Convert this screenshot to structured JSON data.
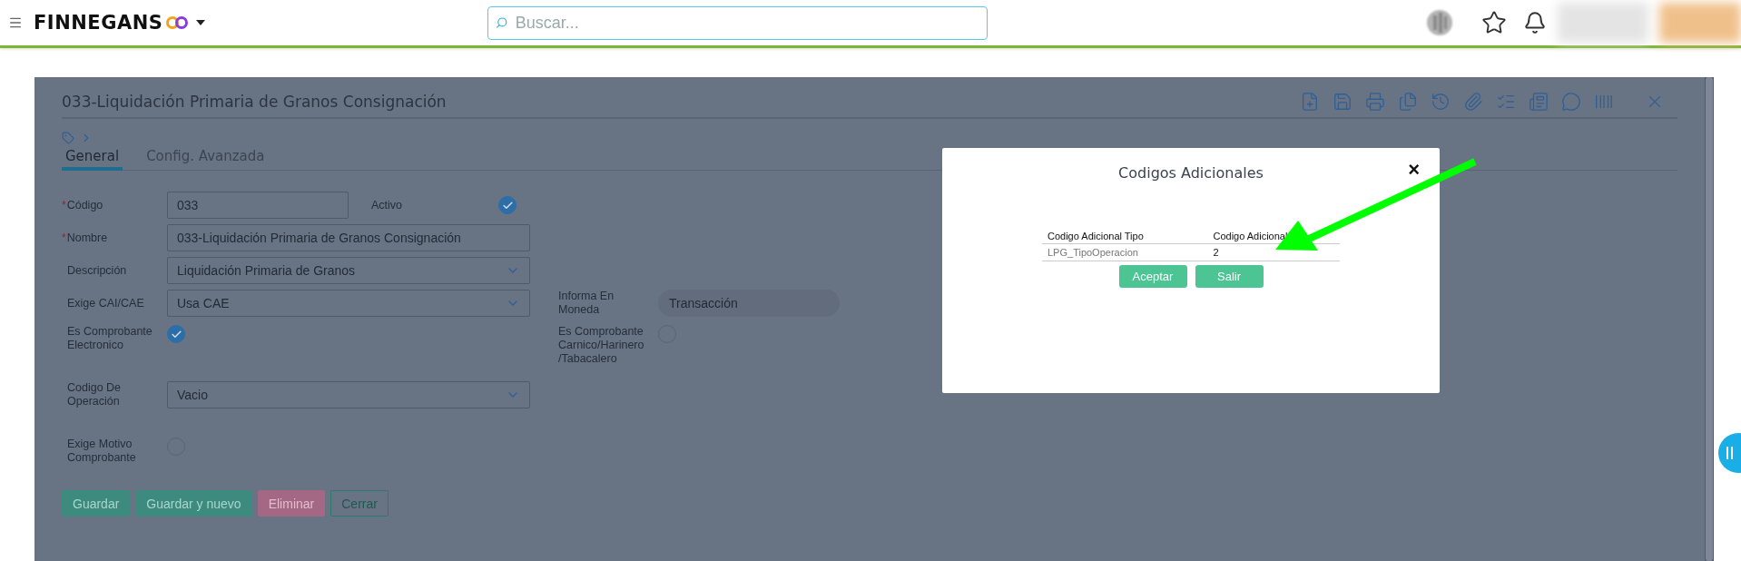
{
  "topbar": {
    "brand": "FINNEGANS",
    "search": {
      "placeholder": "Buscar..."
    }
  },
  "form": {
    "title": "033-Liquidación Primaria de Granos Consignación",
    "tabs": [
      {
        "label": "General",
        "selected": true
      },
      {
        "label": "Config. Avanzada",
        "selected": false
      }
    ],
    "rows": [
      {
        "left": {
          "label": "Código",
          "required_mark": "*",
          "kind": "short_input",
          "value": "033"
        },
        "right": {
          "label": "Activo",
          "kind": "check",
          "checked": true
        }
      },
      {
        "left": {
          "label": "Nombre",
          "required_mark": "*",
          "kind": "input",
          "value": "033-Liquidación Primaria de Granos Consignación"
        }
      },
      {
        "left": {
          "label": "Descripción",
          "kind": "select",
          "value": "Liquidación Primaria de Granos"
        }
      },
      {
        "left": {
          "label": "Exige CAI/CAE",
          "kind": "select",
          "value": "Usa CAE"
        },
        "right": {
          "label": "Informa En Moneda",
          "kind": "readonly",
          "value": "Transacción"
        }
      },
      {
        "left": {
          "label": "Es Comprobante Electronico",
          "kind": "check",
          "checked": true
        },
        "right": {
          "label": "Es Comprobante Carnico/Harinero /Tabacalero",
          "kind": "check",
          "checked": false
        }
      },
      {
        "left": {
          "label": "Codigo De Operación",
          "kind": "select",
          "value": "Vacio"
        }
      },
      {
        "left": {
          "label": "Exige Motivo Comprobante",
          "kind": "check",
          "checked": false
        }
      }
    ],
    "buttons": [
      {
        "label": "Guardar",
        "kind": "primary"
      },
      {
        "label": "Guardar y nuevo",
        "kind": "primary"
      },
      {
        "label": "Eliminar",
        "kind": "danger"
      },
      {
        "label": "Cerrar",
        "kind": "outline"
      }
    ]
  },
  "dialog": {
    "title": "Codigos Adicionales",
    "close": "×",
    "columns": [
      "Codigo Adicional Tipo",
      "Codigo Adicional"
    ],
    "rows": [
      [
        "LPG_TipoOperacion",
        "2"
      ]
    ],
    "buttons": [
      "Aceptar",
      "Salir"
    ]
  }
}
